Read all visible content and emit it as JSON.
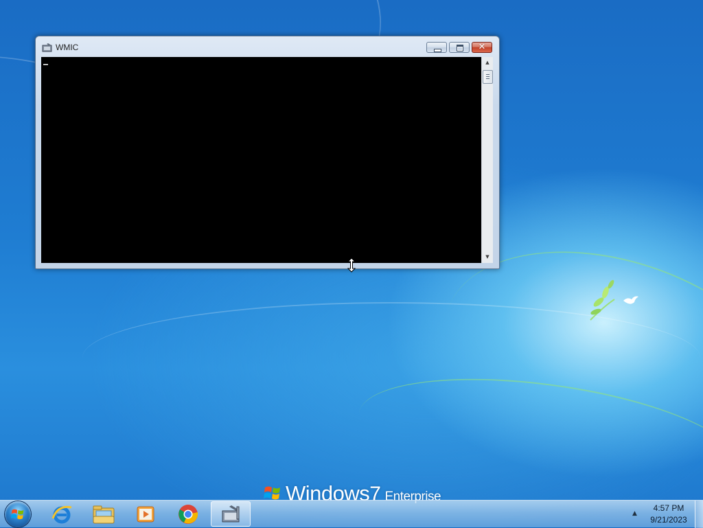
{
  "colors": {
    "desktop_blue": "#1f7dd2",
    "console_background": "#000000",
    "close_button_red": "#c3422a"
  },
  "window": {
    "title": "WMIC",
    "icon": "wmic-tool-icon",
    "controls": {
      "minimize": "minimize-icon",
      "maximize": "maximize-icon",
      "close": "close-icon",
      "close_glyph": "✕"
    },
    "console_text": ""
  },
  "desktop": {
    "brand_windows": "Windows",
    "brand_version": "7",
    "brand_edition": "Enterprise"
  },
  "taskbar": {
    "start": "windows-start-icon",
    "pinned": [
      {
        "name": "internet-explorer-icon"
      },
      {
        "name": "windows-explorer-icon"
      },
      {
        "name": "media-player-icon"
      },
      {
        "name": "chrome-icon"
      },
      {
        "name": "wmic-tool-icon",
        "active": true
      }
    ],
    "tray_arrow": "▲",
    "clock_time": "4:57 PM",
    "clock_date": "9/21/2023"
  }
}
